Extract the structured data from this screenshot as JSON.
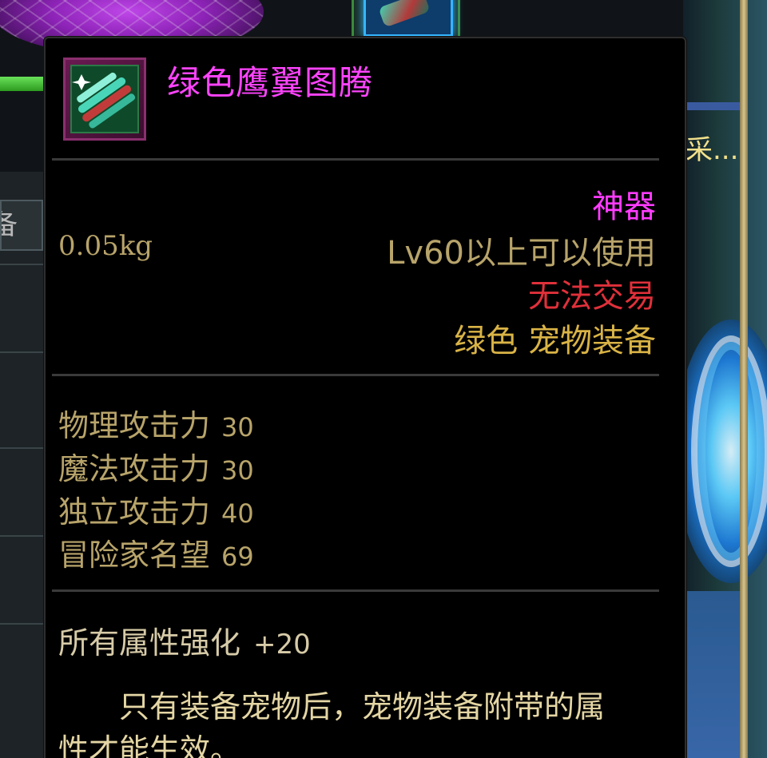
{
  "tooltip": {
    "item_name": "绿色鹰翼图腾",
    "icon": "green-eagle-wing-totem-icon",
    "grade": "神器",
    "weight": "0.05kg",
    "level_requirement": "Lv60以上可以使用",
    "trade_status": "无法交易",
    "category": "绿色  宠物装备",
    "stats": [
      {
        "name": "物理攻击力",
        "value": "30"
      },
      {
        "name": "魔法攻击力",
        "value": "30"
      },
      {
        "name": "独立攻击力",
        "value": "40"
      },
      {
        "name": "冒险家名望",
        "value": "69"
      }
    ],
    "bonus": {
      "name": "所有属性强化",
      "value": "+20"
    },
    "note": "只有装备宠物后，宠物装备附带的属性才能生效。"
  },
  "background": {
    "left_tab_label": "备",
    "right_truncated_text": "采..."
  },
  "colors": {
    "item_name": "#ff44ff",
    "grade": "#ff3cff",
    "trade_status": "#e0303a",
    "category": "#d9b346",
    "stat_text": "#b8a46a",
    "tooltip_bg": "#000000"
  }
}
